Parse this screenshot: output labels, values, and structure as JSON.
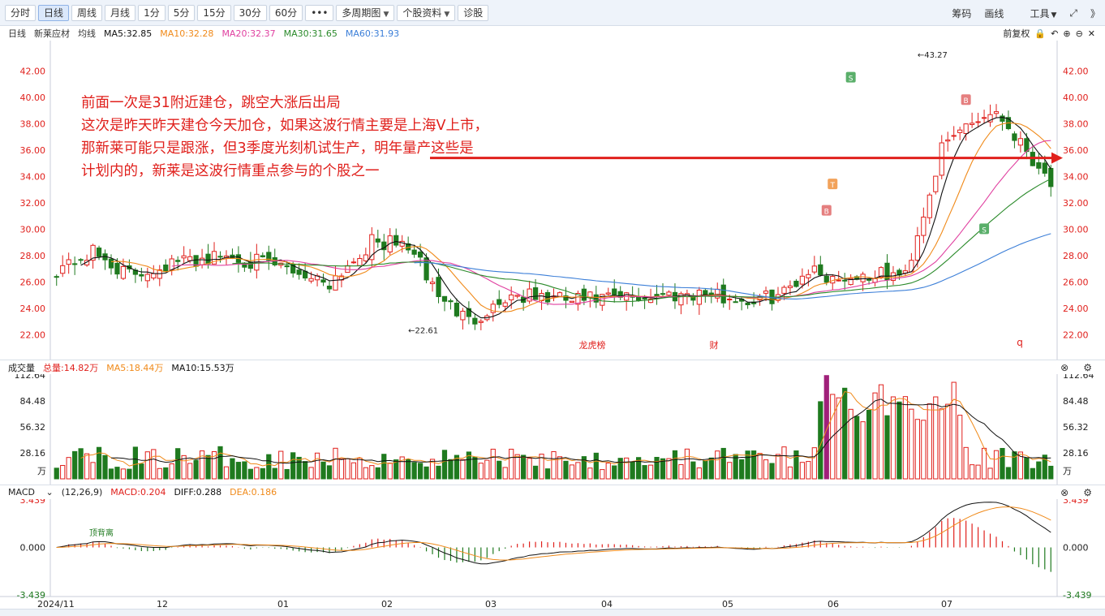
{
  "toolbar": {
    "buttons": [
      "分时",
      "日线",
      "周线",
      "月线",
      "1分",
      "5分",
      "15分",
      "30分",
      "60分",
      "•••",
      "多周期图",
      "个股资料",
      "诊股"
    ],
    "right": [
      "筹码",
      "画线",
      "工具",
      "⤢",
      "》"
    ]
  },
  "info": {
    "period": "日线",
    "name": "新莱应材",
    "ma_label": "均线",
    "ma5": "MA5:32.85",
    "ma10": "MA10:32.28",
    "ma20": "MA20:32.37",
    "ma30": "MA30:31.65",
    "ma60": "MA60:31.93",
    "right_label": "前复权"
  },
  "annotation": [
    "前面一次是31附近建仓，跳空大涨后出局",
    "这次是昨天昨天建仓今天加仓，如果这波行情主要是上海V上市，",
    "那新莱可能只是跟涨，但3季度光刻机试生产，明年量产这些是",
    "计划内的，新莱是这波行情重点参与的个股之一"
  ],
  "price_axis": [
    "42.00",
    "40.00",
    "38.00",
    "36.00",
    "34.00",
    "32.00",
    "30.00",
    "28.00",
    "26.00",
    "24.00",
    "22.00"
  ],
  "price_high": "←43.27",
  "price_low": "←22.61",
  "markers": {
    "bang": "龙虎榜",
    "cai": "财",
    "q": "q"
  },
  "volume": {
    "title": "成交量",
    "total": "总量:14.82万",
    "ma5": "MA5:18.44万",
    "ma10": "MA10:15.53万",
    "axis": [
      "112.64",
      "84.48",
      "56.32",
      "28.16"
    ],
    "unit": "万"
  },
  "macd": {
    "title": "MACD",
    "params": "(12,26,9)",
    "macd": "MACD:0.204",
    "diff": "DIFF:0.288",
    "dea": "DEA:0.186",
    "axis": [
      "3.439",
      "0.000",
      "-3.439"
    ],
    "note": "顶背离"
  },
  "x_axis": [
    "2024/11",
    "12",
    "01",
    "02",
    "03",
    "04",
    "05",
    "06",
    "07"
  ],
  "colors": {
    "up": "#e0201c",
    "down": "#1f7a1f",
    "ma5": "#111111",
    "ma10": "#f08a1a",
    "ma20": "#e040a0",
    "ma30": "#2a8a2a",
    "ma60": "#3c7fd8"
  }
}
